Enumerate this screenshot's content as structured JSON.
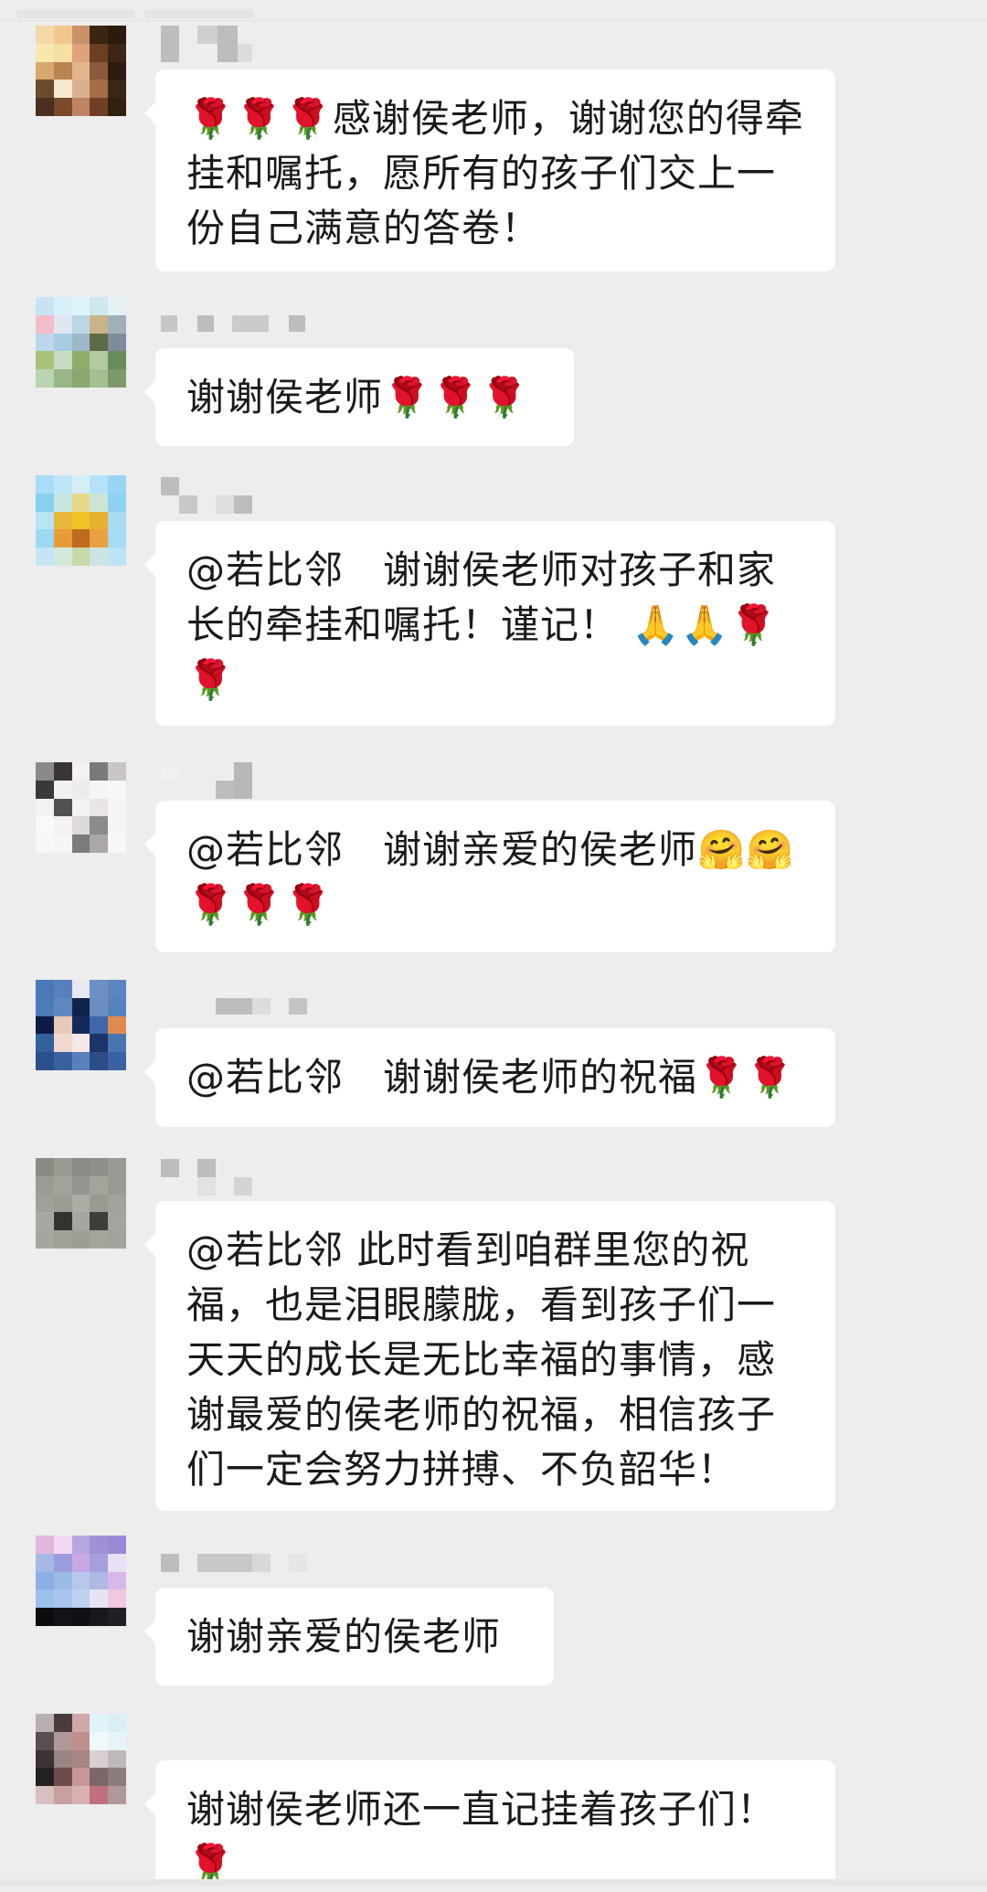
{
  "messages": [
    {
      "text": "🌹🌹🌹感谢侯老师，谢谢您的得牵挂和嘱托，愿所有的孩子们交上一份自己满意的答卷！"
    },
    {
      "text": "谢谢侯老师🌹🌹🌹"
    },
    {
      "text": "@若比邻　谢谢侯老师对孩子和家长的牵挂和嘱托！谨记！ 🙏🙏🌹🌹"
    },
    {
      "text": "@若比邻　谢谢亲爱的侯老师🤗🤗🌹🌹🌹"
    },
    {
      "text": "@若比邻　谢谢侯老师的祝福🌹🌹"
    },
    {
      "text": "@若比邻 此时看到咱群里您的祝福，也是泪眼朦胧，看到孩子们一天天的成长是无比幸福的事情，感谢最爱的侯老师的祝福，相信孩子们一定会努力拼搏、不负韶华！"
    },
    {
      "text": "谢谢亲爱的侯老师"
    },
    {
      "text": "谢谢侯老师还一直记挂着孩子们！🌹"
    }
  ],
  "icons": {
    "avatar": "pixelated-avatar-image",
    "nickname": "pixelated-nickname"
  }
}
